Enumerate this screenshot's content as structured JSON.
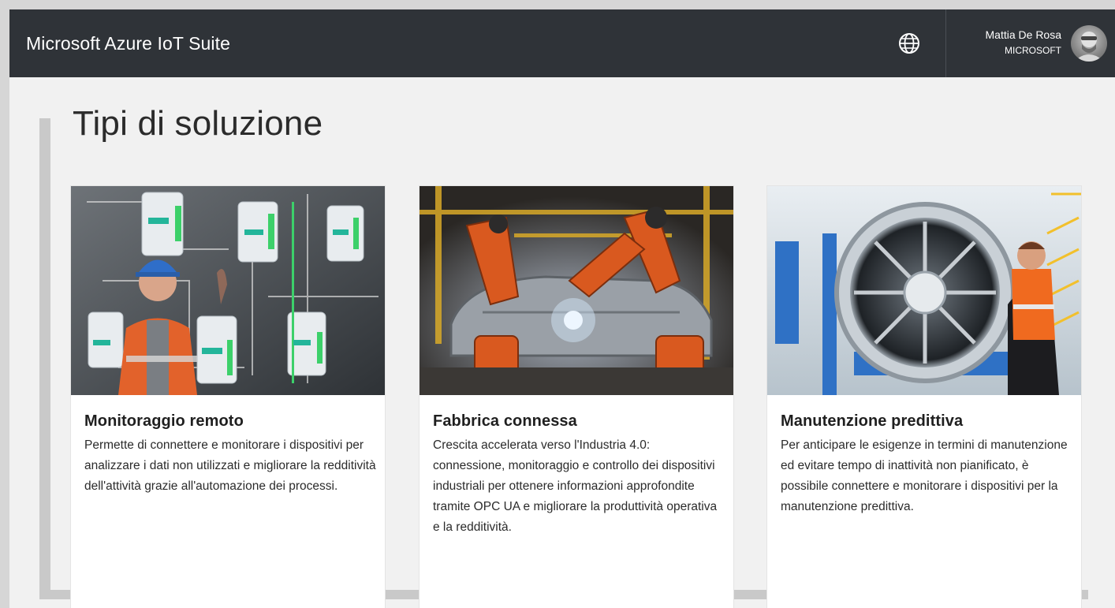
{
  "header": {
    "app_title": "Microsoft Azure IoT Suite",
    "globe_icon": "globe-icon",
    "user": {
      "name": "Mattia De Rosa",
      "org": "MICROSOFT",
      "avatar_icon": "user-avatar"
    }
  },
  "page": {
    "title": "Tipi di soluzione"
  },
  "cards": [
    {
      "title": "Monitoraggio remoto",
      "description": "Permette di connettere e monitorare i dispositivi per analizzare i dati non utilizzati e migliorare la redditività dell'attività grazie all'automazione dei processi.",
      "image_icon": "industrial-control-panel-photo"
    },
    {
      "title": "Fabbrica connessa",
      "description": "Crescita accelerata verso l'Industria 4.0: connessione, monitoraggio e controllo dei dispositivi industriali per ottenere informazioni approfondite tramite OPC UA e migliorare la produttività operativa e la redditività.",
      "image_icon": "robotic-welding-photo"
    },
    {
      "title": "Manutenzione predittiva",
      "description": "Per anticipare le esigenze in termini di manutenzione ed evitare tempo di inattività non pianificato, è possibile connettere e monitorare i dispositivi per la manutenzione predittiva.",
      "image_icon": "jet-engine-photo"
    }
  ],
  "colors": {
    "header_bg": "#2f3338",
    "page_bg": "#f1f1f1",
    "card_bg": "#ffffff",
    "accent_panel": "#c9c9c9"
  }
}
